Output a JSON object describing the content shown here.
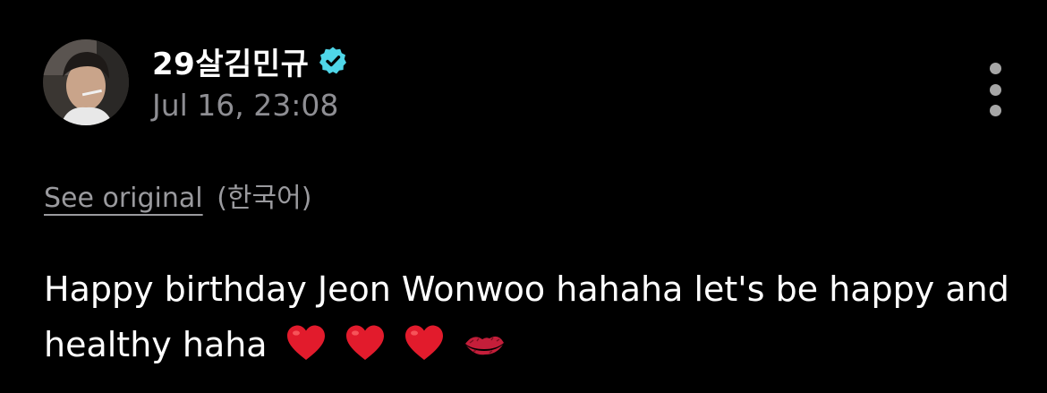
{
  "post": {
    "username": "29살김민규",
    "timestamp": "Jul 16, 23:08",
    "translate": {
      "see_original": "See original",
      "language": "(한국어)"
    },
    "text": "Happy birthday Jeon Wonwoo hahaha let's be happy and healthy haha",
    "emojis": [
      "red-heart-icon",
      "red-heart-icon",
      "red-heart-icon",
      "kiss-mark-icon"
    ]
  },
  "icons": {
    "verified": "verified-badge-icon",
    "more": "more-options-icon"
  },
  "colors": {
    "background": "#000000",
    "text": "#ffffff",
    "secondary_text": "#8e8e93",
    "verified": "#4fd6e8",
    "heart": "#e21b2c",
    "kiss": "#c41e3a"
  }
}
